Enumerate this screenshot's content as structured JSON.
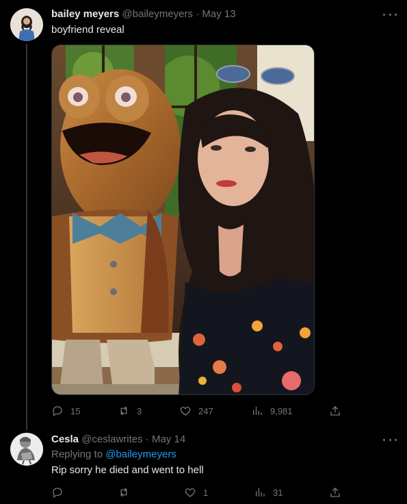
{
  "tweet1": {
    "display_name": "bailey meyers",
    "handle": "@baileymeyers",
    "separator": "·",
    "date": "May 13",
    "text": "boyfriend reveal",
    "stats": {
      "replies": "15",
      "retweets": "3",
      "likes": "247",
      "views": "9,981"
    }
  },
  "tweet2": {
    "display_name": "Cesla",
    "handle": "@ceslawrites",
    "separator": "·",
    "date": "May 14",
    "replying_prefix": "Replying to",
    "replying_handle": "@baileymeyers",
    "text": "Rip sorry he died and went to hell",
    "stats": {
      "replies": "",
      "retweets": "",
      "likes": "1",
      "views": "31"
    }
  },
  "icons": {
    "reply": "reply-icon",
    "retweet": "retweet-icon",
    "like": "heart-icon",
    "views": "views-icon",
    "share": "share-icon",
    "more": "more-icon"
  },
  "colors": {
    "background": "#000000",
    "text": "#e7e9ea",
    "secondary": "#71767b",
    "link": "#1d9bf0",
    "border": "#2f3336"
  }
}
